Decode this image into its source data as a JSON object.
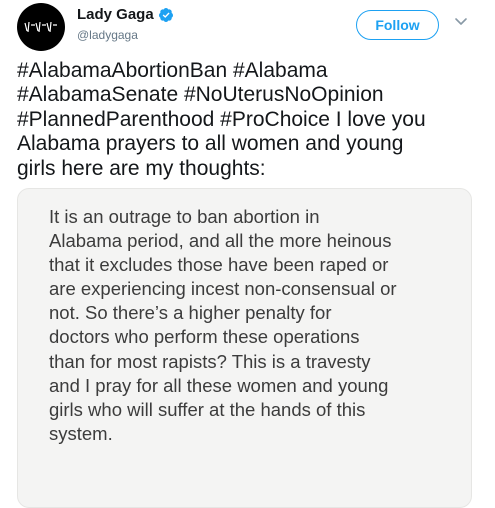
{
  "account": {
    "display_name": "Lady Gaga",
    "handle": "@ladygaga",
    "avatar_icon": "avatar-icon",
    "verified_icon": "verified-badge-icon",
    "verified_color": "#1da1f2"
  },
  "actions": {
    "follow_label": "Follow",
    "menu_icon": "chevron-down-icon"
  },
  "tweet": {
    "lines": [
      "#AlabamaAbortionBan #Alabama",
      "#AlabamaSenate #NoUterusNoOpinion",
      "#PlannedParenthood #ProChoice I love you",
      "Alabama prayers to all women and young",
      "girls here are my thoughts:"
    ]
  },
  "attached_note": {
    "lines": [
      "It is an outrage to ban abortion in",
      "Alabama period, and all the more heinous",
      "that it excludes those have been raped or",
      "are experiencing incest non-consensual or",
      "not. So there’s a higher penalty for",
      "doctors who perform these operations",
      "than for most rapists? This is a travesty",
      "and I pray for all these women and young",
      "girls who will suffer at the hands of this",
      "system."
    ]
  },
  "colors": {
    "accent": "#1da1f2",
    "text_primary": "#14171a",
    "text_secondary": "#657786",
    "note_background": "#f4f4f3"
  }
}
